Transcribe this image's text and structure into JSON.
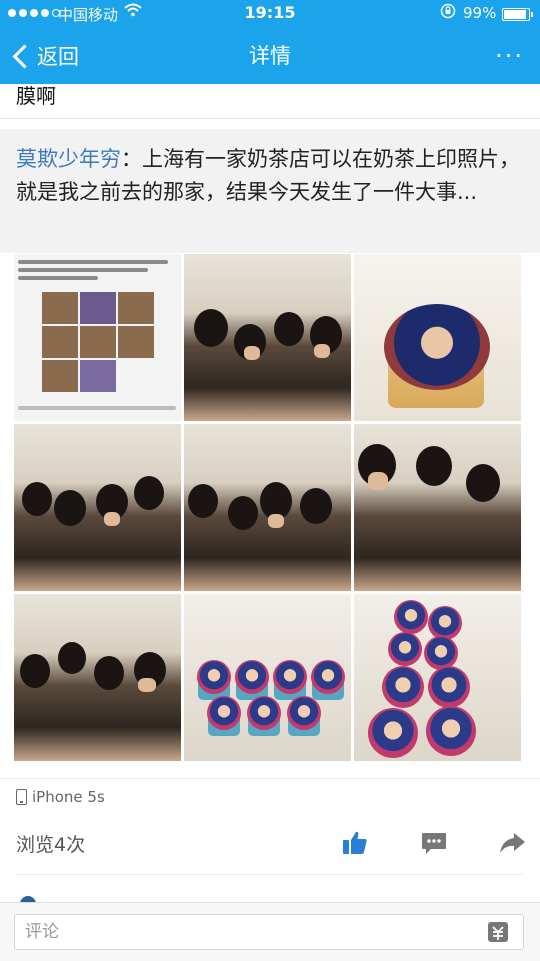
{
  "status_bar": {
    "carrier": "中国移动",
    "time": "19:15",
    "battery_percent": "99%",
    "battery_level": 0.99
  },
  "nav": {
    "back_label": "返回",
    "title": "详情",
    "more_label": "···"
  },
  "previous_text": "膜啊",
  "repost": {
    "author": "莫欺少年穷",
    "separator": "：",
    "content": "上海有一家奶茶店可以在奶茶上印照片，就是我之前去的那家，结果今天发生了一件大事..."
  },
  "photos": {
    "count": 9,
    "tiles": [
      {
        "type": "chat-screenshot"
      },
      {
        "type": "crowd"
      },
      {
        "type": "printed-cup"
      },
      {
        "type": "crowd"
      },
      {
        "type": "crowd"
      },
      {
        "type": "crowd"
      },
      {
        "type": "crowd"
      },
      {
        "type": "cups-row"
      },
      {
        "type": "cups-stack"
      }
    ]
  },
  "device": "iPhone 5s",
  "views": "浏览4次",
  "actions": {
    "like_icon": "thumbs-up-icon",
    "comment_icon": "comment-icon",
    "share_icon": "share-icon"
  },
  "comment_bar": {
    "placeholder": "评论",
    "emoji_icon": "emoji-icon"
  },
  "colors": {
    "brand_blue": "#1ba3ec",
    "author_link": "#3b7bbf",
    "icon_blue": "#2a7fd4",
    "icon_gray": "#777777"
  }
}
